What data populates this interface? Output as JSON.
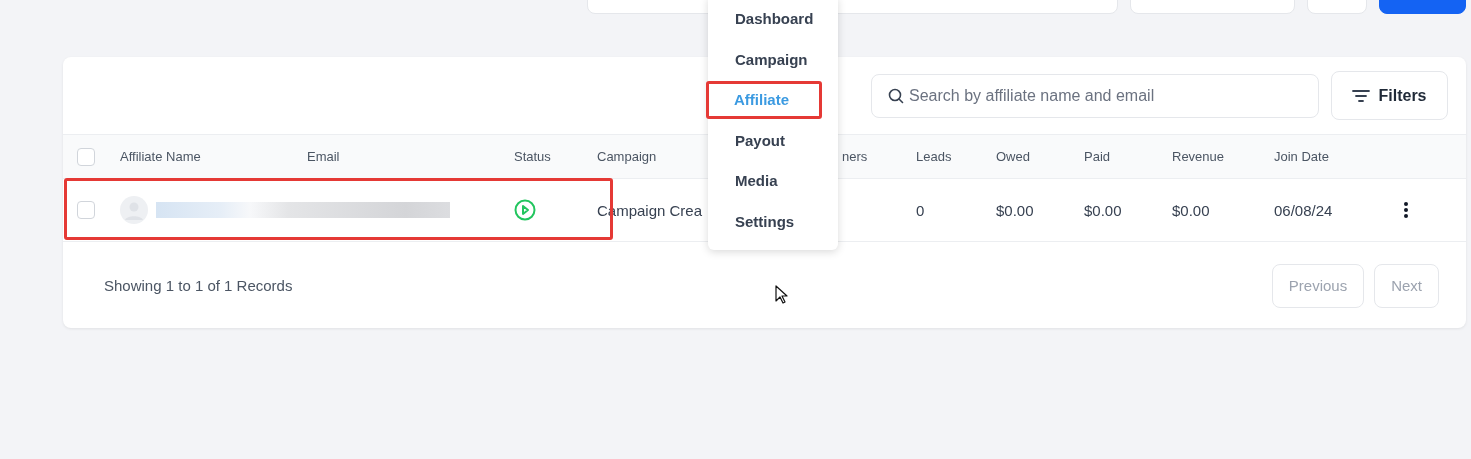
{
  "search": {
    "placeholder": "Search by affiliate name and email"
  },
  "filters_button": {
    "label": "Filters"
  },
  "table": {
    "columns": [
      {
        "label": "Affiliate Name"
      },
      {
        "label": "Email"
      },
      {
        "label": "Status"
      },
      {
        "label": "Campaign"
      },
      {
        "label": "ners"
      },
      {
        "label": "Leads"
      },
      {
        "label": "Owed"
      },
      {
        "label": "Paid"
      },
      {
        "label": "Revenue"
      },
      {
        "label": "Join Date"
      }
    ],
    "all_selected": false,
    "rows": [
      {
        "checked": false,
        "highlighted": true,
        "active": true,
        "campaign": "Campaign Crea",
        "leads": "0",
        "owed": "$0.00",
        "paid": "$0.00",
        "revenue": "$0.00",
        "join_date": "06/08/24"
      }
    ]
  },
  "footer": {
    "summary": "Showing 1 to 1 of 1 Records",
    "previous": "Previous",
    "next": "Next"
  },
  "menu": {
    "items": [
      {
        "label": "Dashboard",
        "selected": false,
        "highlighted": false
      },
      {
        "label": "Campaign",
        "selected": false,
        "highlighted": false
      },
      {
        "label": "Affiliate",
        "selected": true,
        "highlighted": true
      },
      {
        "label": "Payout",
        "selected": false,
        "highlighted": false
      },
      {
        "label": "Media",
        "selected": false,
        "highlighted": false
      },
      {
        "label": "Settings",
        "selected": false,
        "highlighted": false
      }
    ]
  }
}
